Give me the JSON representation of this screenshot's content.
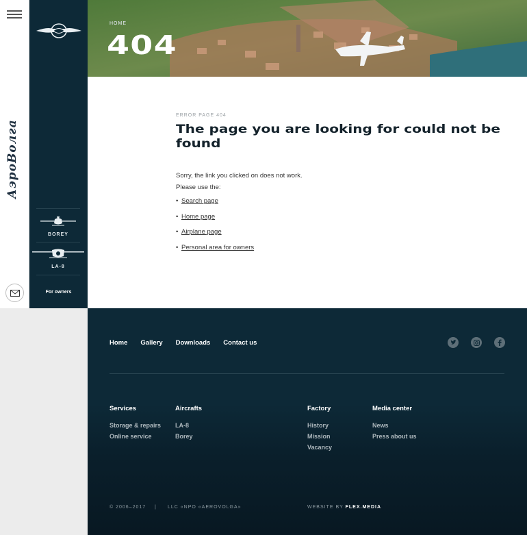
{
  "sidebar": {
    "planes": [
      {
        "label": "BOREY"
      },
      {
        "label": "LA-8"
      }
    ],
    "owners_label": "For owners"
  },
  "hero": {
    "breadcrumb": "HOME",
    "code": "404"
  },
  "main": {
    "eyebrow": "ERROR PAGE 404",
    "title": "The page you are looking for could not be found",
    "line1": "Sorry, the link you clicked on does not work.",
    "line2": "Please use the:",
    "links": [
      {
        "label": "Search page"
      },
      {
        "label": "Home page"
      },
      {
        "label": "Airplane page"
      },
      {
        "label": "Personal area for owners"
      }
    ]
  },
  "footer": {
    "nav": [
      {
        "label": "Home"
      },
      {
        "label": "Gallery"
      },
      {
        "label": "Downloads"
      },
      {
        "label": "Contact us"
      }
    ],
    "social": [
      "twitter-icon",
      "instagram-icon",
      "facebook-icon"
    ],
    "columns": [
      {
        "head": "Services",
        "items": [
          "Storage & repairs",
          "Online service"
        ]
      },
      {
        "head": "Aircrafts",
        "items": [
          "LA-8",
          "Borey"
        ]
      },
      {
        "head": "Factory",
        "items": [
          "History",
          "Mission",
          "Vacancy"
        ]
      },
      {
        "head": "Media center",
        "items": [
          "News",
          "Press about us"
        ]
      }
    ],
    "copyright": "© 2006–2017",
    "separator": "|",
    "company": "LLC «NPO «AEROVOLGA»",
    "credit_prefix": "WEBSITE BY",
    "credit_name": "FLEX.MEDIA"
  },
  "colors": {
    "dark": "#0d2937",
    "text": "#14222b",
    "muted": "#9aa0a4"
  }
}
